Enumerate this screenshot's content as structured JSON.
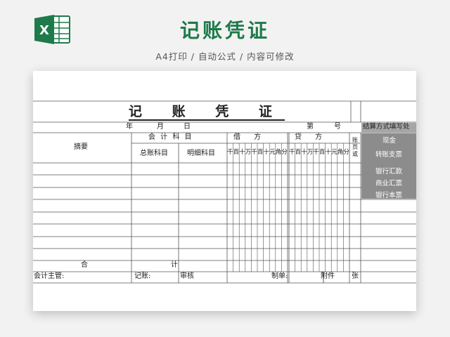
{
  "header": {
    "title": "记账凭证",
    "subtitle": "A4打印 / 自动公式 / 内容可修改"
  },
  "logo": {
    "icon": "excel-icon",
    "letter": "X",
    "color": "#1e7a4a"
  },
  "voucher": {
    "title": "记 账 凭 证",
    "date_year": "年",
    "date_month": "月",
    "date_day": "日",
    "number_label": "第",
    "number_unit": "号",
    "col_summary": "摘要",
    "col_subject": "会 计 科 目",
    "col_general": "总账科目",
    "col_detail": "明细科目",
    "col_debit": "借      方",
    "col_credit": "贷      方",
    "col_account": "账页或",
    "digits": [
      "千",
      "百",
      "十",
      "万",
      "千",
      "百",
      "十",
      "元",
      "角",
      "分"
    ],
    "total_left": "合",
    "total_right": "计",
    "footer": {
      "chief": "会计主管:",
      "bookkeeper": "记账:",
      "audit": "审核",
      "maker": "制单:",
      "attachment": "附件",
      "sheets": "张"
    }
  },
  "payment": {
    "header": "结算方式填写处",
    "options": [
      "现金",
      "转账支票",
      "银行汇款",
      "商业汇票",
      "银行本票"
    ]
  }
}
